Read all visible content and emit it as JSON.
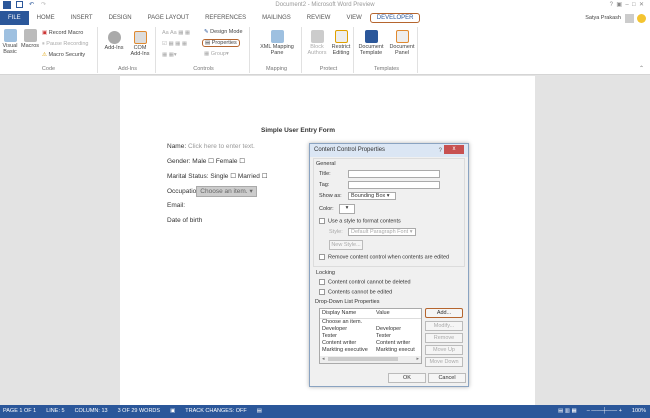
{
  "window": {
    "title": "Document2 - Microsoft Word Preview",
    "user": "Satya Prakash"
  },
  "tabs": [
    "FILE",
    "HOME",
    "INSERT",
    "DESIGN",
    "PAGE LAYOUT",
    "REFERENCES",
    "MAILINGS",
    "REVIEW",
    "VIEW",
    "DEVELOPER"
  ],
  "ribbon": {
    "code": {
      "label": "Code",
      "visual_basic": "Visual Basic",
      "macros": "Macros",
      "record_macro": "Record Macro",
      "pause_recording": "Pause Recording",
      "macro_security": "Macro Security"
    },
    "addins": {
      "label": "Add-Ins",
      "addins": "Add-Ins",
      "com_addins": "COM Add-Ins"
    },
    "controls": {
      "label": "Controls",
      "design_mode": "Design Mode",
      "properties": "Properties",
      "group": "Group"
    },
    "mapping": {
      "label": "Mapping",
      "xml_pane": "XML Mapping Pane"
    },
    "protect": {
      "label": "Protect",
      "block_authors": "Block Authors",
      "restrict_editing": "Restrict Editing"
    },
    "templates": {
      "label": "Templates",
      "document_template": "Document Template",
      "document_panel": "Document Panel"
    }
  },
  "document": {
    "title": "Simple User Entry Form",
    "name_label": "Name:",
    "name_placeholder": "Click here to enter text.",
    "gender": "Gender: Male ☐ Female ☐",
    "marital": "Marital Status:  Single ☐ Married ☐",
    "occupation_label": "Occupatio",
    "occupation_value": "Choose an item.",
    "email": "Email:",
    "dob": "Date of birth"
  },
  "dialog": {
    "title": "Content Control Properties",
    "help": "?",
    "close": "x",
    "general": "General",
    "title_label": "Title:",
    "tag_label": "Tag:",
    "show_as_label": "Show as:",
    "show_as_value": "Bounding Box",
    "color_label": "Color:",
    "use_style": "Use a style to format contents",
    "style_label": "Style:",
    "style_value": "Default Paragraph Font",
    "new_style": "New Style...",
    "remove_when_edited": "Remove content control when contents are edited",
    "locking": "Locking",
    "cannot_delete": "Content control cannot be deleted",
    "cannot_edit": "Contents cannot be edited",
    "ddl_props": "Drop-Down List Properties",
    "columns": [
      "Display Name",
      "Value"
    ],
    "rows": [
      [
        "Choose an item.",
        ""
      ],
      [
        "Developer",
        "Developer"
      ],
      [
        "Tester",
        "Tester"
      ],
      [
        "Content writer",
        "Content writer"
      ],
      [
        "Markting executive",
        "Markting execut"
      ]
    ],
    "buttons": {
      "add": "Add...",
      "modify": "Modify...",
      "remove": "Remove",
      "move_up": "Move Up",
      "move_down": "Move Down",
      "ok": "OK",
      "cancel": "Cancel"
    }
  },
  "status": {
    "page": "PAGE 1 OF 1",
    "line": "LINE: 5",
    "column": "COLUMN: 13",
    "words": "3 OF 29 WORDS",
    "track": "TRACK CHANGES: OFF",
    "zoom": "100%"
  }
}
